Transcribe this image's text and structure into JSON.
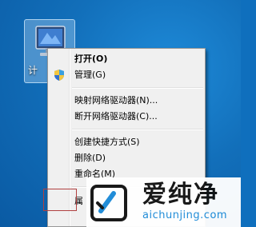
{
  "desktop": {
    "icon": {
      "name": "computer-icon",
      "label": "计"
    }
  },
  "context_menu": {
    "items": [
      {
        "label": "打开(O)",
        "bold": true
      },
      {
        "label": "管理(G)",
        "icon": "uac-shield-icon"
      },
      {
        "label": "映射网络驱动器(N)..."
      },
      {
        "label": "断开网络驱动器(C)..."
      },
      {
        "label": "创建快捷方式(S)"
      },
      {
        "label": "删除(D)"
      },
      {
        "label": "重命名(M)"
      },
      {
        "label": "属"
      }
    ]
  },
  "watermark": {
    "brand": "爱纯净",
    "url": "aichunjing.com",
    "accent_color": "#1a8ad8"
  }
}
